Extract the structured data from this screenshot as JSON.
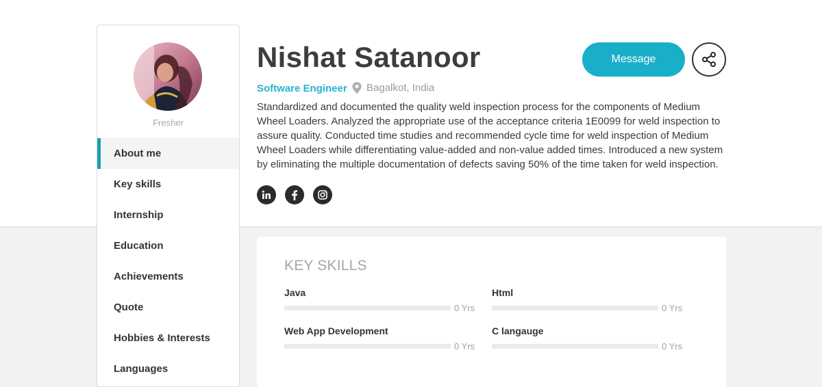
{
  "profile": {
    "name": "Nishat Satanoor",
    "role": "Software Engineer",
    "location": "Bagalkot, India",
    "status": "Fresher",
    "bio": "Standardized and documented the quality weld inspection process for the components of Medium Wheel Loaders. Analyzed the appropriate use of the acceptance criteria 1E0099 for weld inspection to assure quality. Conducted time studies and recommended cycle time for weld inspection of Medium Wheel Loaders while differentiating value-added and non-value added times. Introduced a new system by eliminating the multiple documentation of defects saving 50% of the time taken for weld inspection."
  },
  "actions": {
    "message_label": "Message",
    "share_icon": "share-icon"
  },
  "socials": [
    {
      "icon": "linkedin-icon",
      "glyph": "in"
    },
    {
      "icon": "facebook-icon",
      "glyph": "f"
    },
    {
      "icon": "instagram-icon",
      "glyph": ""
    }
  ],
  "nav": {
    "items": [
      {
        "label": "About me",
        "active": true
      },
      {
        "label": "Key skills",
        "active": false
      },
      {
        "label": "Internship",
        "active": false
      },
      {
        "label": "Education",
        "active": false
      },
      {
        "label": "Achievements",
        "active": false
      },
      {
        "label": "Quote",
        "active": false
      },
      {
        "label": "Hobbies & Interests",
        "active": false
      },
      {
        "label": "Languages",
        "active": false
      }
    ]
  },
  "skills": {
    "title": "KEY SKILLS",
    "items": [
      {
        "name": "Java",
        "years": "0 Yrs",
        "level": 0
      },
      {
        "name": "Html",
        "years": "0 Yrs",
        "level": 0
      },
      {
        "name": "Web App Development",
        "years": "0 Yrs",
        "level": 0
      },
      {
        "name": "C langauge",
        "years": "0 Yrs",
        "level": 0
      }
    ]
  },
  "colors": {
    "accent": "#19afc9",
    "role_text": "#29b3cf",
    "active_bar": "#1a9db5",
    "social_bg": "#2b2b2b"
  }
}
